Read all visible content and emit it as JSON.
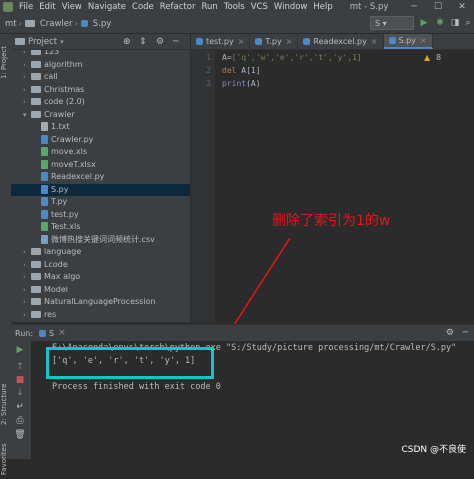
{
  "menubar": {
    "items": [
      "File",
      "Edit",
      "View",
      "Navigate",
      "Code",
      "Refactor",
      "Run",
      "Tools",
      "VCS",
      "Window",
      "Help"
    ],
    "title": "mt - S.py"
  },
  "navbar": {
    "crumbs": [
      "mt",
      "Crawler",
      "S.py"
    ],
    "run_config": "S"
  },
  "side": {
    "project_label": "1: Project",
    "structure_label": "2: Structure",
    "favorites_label": "Favorites"
  },
  "project": {
    "header": "Project"
  },
  "tree": [
    {
      "label": "123",
      "indent": 1,
      "kind": "folder",
      "arrow": ">"
    },
    {
      "label": "algorithm",
      "indent": 1,
      "kind": "folder",
      "arrow": ">"
    },
    {
      "label": "call",
      "indent": 1,
      "kind": "folder",
      "arrow": ">"
    },
    {
      "label": "Christmas",
      "indent": 1,
      "kind": "folder",
      "arrow": ">"
    },
    {
      "label": "code  (2.0)",
      "indent": 1,
      "kind": "folder",
      "arrow": ">"
    },
    {
      "label": "Crawler",
      "indent": 1,
      "kind": "folder",
      "arrow": "v"
    },
    {
      "label": "1.txt",
      "indent": 2,
      "kind": "txt",
      "arrow": ""
    },
    {
      "label": "Crawler.py",
      "indent": 2,
      "kind": "py",
      "arrow": ""
    },
    {
      "label": "move.xls",
      "indent": 2,
      "kind": "xls",
      "arrow": ""
    },
    {
      "label": "moveT.xlsx",
      "indent": 2,
      "kind": "xls",
      "arrow": ""
    },
    {
      "label": "Readexcel.py",
      "indent": 2,
      "kind": "py",
      "arrow": ""
    },
    {
      "label": "S.py",
      "indent": 2,
      "kind": "py",
      "arrow": "",
      "selected": true
    },
    {
      "label": "T.py",
      "indent": 2,
      "kind": "py",
      "arrow": ""
    },
    {
      "label": "test.py",
      "indent": 2,
      "kind": "py",
      "arrow": ""
    },
    {
      "label": "Test.xls",
      "indent": 2,
      "kind": "xls",
      "arrow": ""
    },
    {
      "label": "微博热搜关键词词频统计.csv",
      "indent": 2,
      "kind": "csv",
      "arrow": ""
    },
    {
      "label": "language",
      "indent": 1,
      "kind": "folder",
      "arrow": ">"
    },
    {
      "label": "Lcode",
      "indent": 1,
      "kind": "folder",
      "arrow": ">"
    },
    {
      "label": "Max algo",
      "indent": 1,
      "kind": "folder",
      "arrow": ">"
    },
    {
      "label": "Model",
      "indent": 1,
      "kind": "folder",
      "arrow": ">"
    },
    {
      "label": "NaturalLanguageProcession",
      "indent": 1,
      "kind": "folder",
      "arrow": ">"
    },
    {
      "label": "res",
      "indent": 1,
      "kind": "folder",
      "arrow": ">"
    }
  ],
  "tabs": [
    "test.py",
    "T.py",
    "Readexcel.py",
    "S.py"
  ],
  "editor": {
    "line_numbers": [
      "1",
      "2",
      "3"
    ],
    "warning_count": "8",
    "line1": {
      "var": "A",
      "eq": "=",
      "items": "['q','w','e','r','t','y',1]"
    },
    "line2": {
      "kw": "del",
      "rest": " A[1]"
    },
    "line3": {
      "fn": "print",
      "rest": "(A)"
    }
  },
  "annotation": "删除了索引为1的w",
  "run": {
    "tab_label": "Run:",
    "config": "S",
    "cmd": "E:\\Anaconda\\envs\\torch\\python.exe \"S:/Study/picture processing/mt/Crawler/S.py\"",
    "output": "['q', 'e', 'r', 't', 'y', 1]",
    "exit": "Process finished with exit code 0"
  },
  "watermark": "CSDN @不良使",
  "colors": {
    "accent": "#4a88c7",
    "highlight": "#17c3c9",
    "annotation": "#e8141c"
  }
}
